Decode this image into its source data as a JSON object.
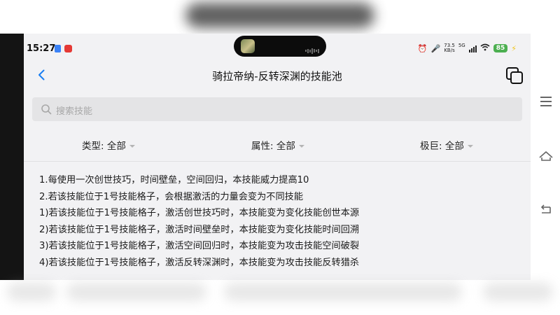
{
  "status_bar": {
    "time": "15:27",
    "net_speed_value": "73.5",
    "net_speed_unit": "KB/s",
    "network_type": "5G",
    "battery": "85",
    "icons": [
      "alarm-icon",
      "vibrate-icon",
      "signal-icon",
      "wifi-icon",
      "battery-icon",
      "charging-icon"
    ]
  },
  "header": {
    "title": "骑拉帝纳-反转深渊的技能池",
    "back_icon": "chevron-left-icon",
    "action_icon": "copy-icon",
    "accent_color": "#1a7ef2"
  },
  "search": {
    "placeholder": "搜索技能"
  },
  "filters": {
    "type_label": "类型:",
    "type_value": "全部",
    "attr_label": "属性:",
    "attr_value": "全部",
    "max_label": "极巨:",
    "max_value": "全部"
  },
  "description": {
    "lines": [
      "1.每使用一次创世技巧，时间壁垒，空间回归，本技能威力提高10",
      "2.若该技能位于1号技能格子，会根据激活的力量会变为不同技能",
      "1)若该技能位于1号技能格子，激活创世技巧时，本技能变为变化技能创世本源",
      "2)若该技能位于1号技能格子，激活时间壁垒时，本技能变为变化技能时间回溯",
      "3)若该技能位于1号技能格子，激活空间回归时，本技能变为攻击技能空间破裂",
      "4)若该技能位于1号技能格子，激活反转深渊时，本技能变为攻击技能反转猎杀"
    ]
  },
  "nav_bar": {
    "icons": [
      "menu-icon",
      "home-icon",
      "back-icon"
    ]
  }
}
